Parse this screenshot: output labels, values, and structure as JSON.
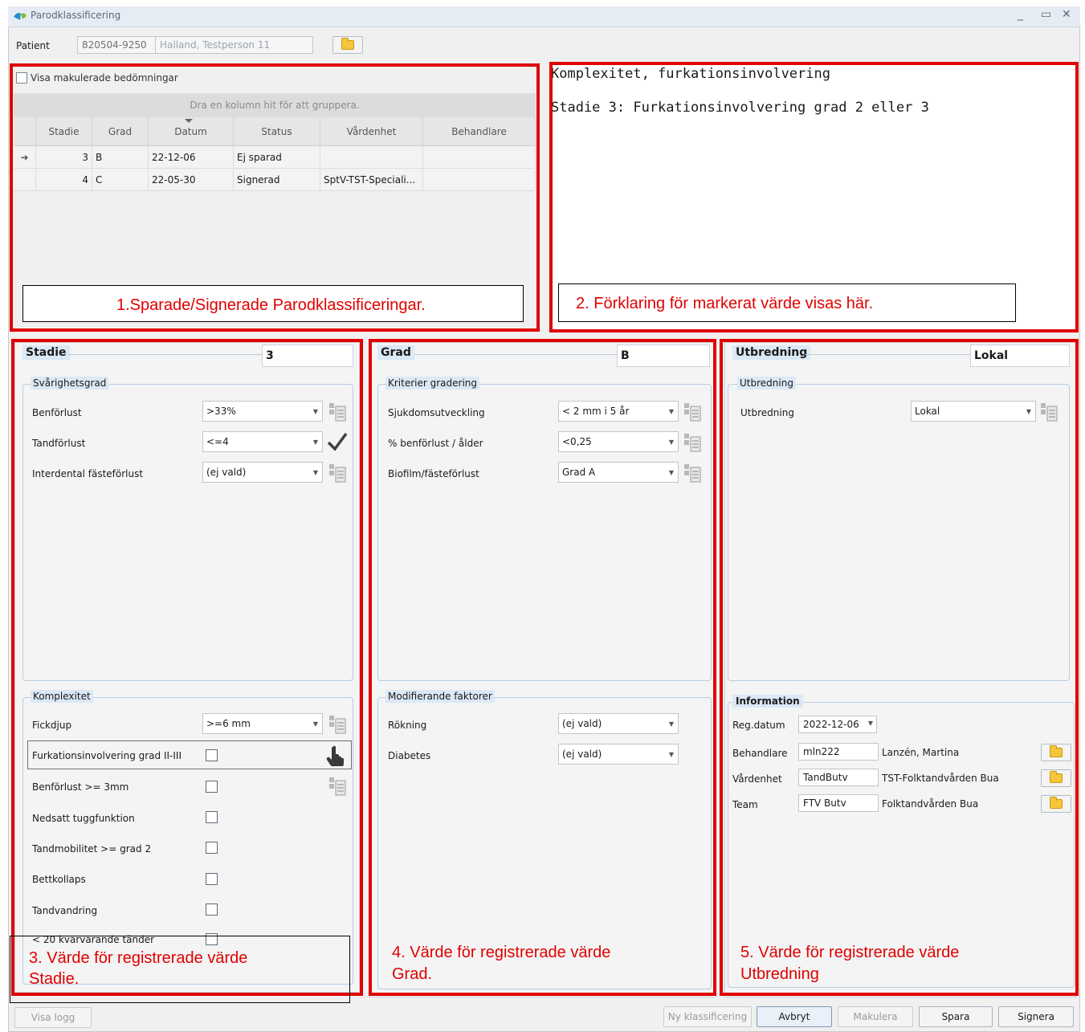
{
  "window": {
    "title": "Parodklassificering",
    "controls": [
      "_",
      "▭",
      "✕"
    ]
  },
  "patient": {
    "label": "Patient",
    "id": "820504-9250",
    "name": "Halland, Testperson 11"
  },
  "history": {
    "checkbox_label": "Visa makulerade bedömningar",
    "group_hint": "Dra en kolumn hit för att gruppera.",
    "columns": [
      "Stadie",
      "Grad",
      "Datum",
      "Status",
      "Vårdenhet",
      "Behandlare"
    ],
    "rows": [
      {
        "stadie": "3",
        "grad": "B",
        "datum": "22-12-06",
        "status": "Ej sparad",
        "vardenhet": "",
        "behandlare": ""
      },
      {
        "stadie": "4",
        "grad": "C",
        "datum": "22-05-30",
        "status": "Signerad",
        "vardenhet": "SptV-TST-Speciali...",
        "behandlare": ""
      }
    ]
  },
  "explanation": {
    "title": "Komplexitet, furkationsinvolvering",
    "text": "Stadie 3: Furkationsinvolvering grad 2 eller 3"
  },
  "annotations": {
    "a1": "1.Sparade/Signerade Parodklassificeringar.",
    "a2": "2. Förklaring för markerat värde visas här.",
    "a3_line1": "3. Värde för registrerade värde",
    "a3_line2": "Stadie.",
    "a4_line1": "4. Värde för registrerade värde",
    "a4_line2": "Grad.",
    "a5_line1": "5. Värde för registrerade värde",
    "a5_line2": "Utbredning"
  },
  "stadie": {
    "title": "Stadie",
    "value": "3",
    "svarighetsgrad": {
      "title": "Svårighetsgrad",
      "rows": [
        {
          "label": "Benförlust",
          "value": ">33%"
        },
        {
          "label": "Tandförlust",
          "value": "<=4"
        },
        {
          "label": "Interdental fästeförlust",
          "value": "(ej vald)"
        }
      ]
    },
    "komplexitet": {
      "title": "Komplexitet",
      "fickdjup_label": "Fickdjup",
      "fickdjup_value": ">=6 mm",
      "checks": [
        "Furkationsinvolvering grad II-III",
        "Benförlust >= 3mm",
        "Nedsatt tuggfunktion",
        "Tandmobilitet >= grad 2",
        "Bettkollaps",
        "Tandvandring",
        "< 20 kvarvarande tänder"
      ]
    }
  },
  "grad": {
    "title": "Grad",
    "value": "B",
    "kriterier": {
      "title": "Kriterier gradering",
      "rows": [
        {
          "label": "Sjukdomsutveckling",
          "value": "< 2 mm i 5 år"
        },
        {
          "label": "% benförlust / ålder",
          "value": "<0,25"
        },
        {
          "label": "Biofilm/fästeförlust",
          "value": "Grad A"
        }
      ]
    },
    "modifierande": {
      "title": "Modifierande faktorer",
      "rows": [
        {
          "label": "Rökning",
          "value": "(ej vald)"
        },
        {
          "label": "Diabetes",
          "value": "(ej vald)"
        }
      ]
    }
  },
  "utbredning": {
    "title": "Utbredning",
    "value": "Lokal",
    "group_title": "Utbredning",
    "row_label": "Utbredning",
    "row_value": "Lokal"
  },
  "information": {
    "title": "Information",
    "regdatum_label": "Reg.datum",
    "regdatum_value": "2022-12-06",
    "rows": [
      {
        "label": "Behandlare",
        "code": "mln222",
        "name": "Lanzén, Martina"
      },
      {
        "label": "Vårdenhet",
        "code": "TandButv",
        "name": "TST-Folktandvården Bua"
      },
      {
        "label": "Team",
        "code": "FTV Butv",
        "name": "Folktandvården Bua"
      }
    ]
  },
  "footer": {
    "visa_logg": "Visa logg",
    "ny_klassificering": "Ny klassificering",
    "avbryt": "Avbryt",
    "makulera": "Makulera",
    "spara": "Spara",
    "signera": "Signera"
  },
  "colors": {
    "annotation_red": "#e00000",
    "group_header_blue": "#dbe8f5"
  }
}
